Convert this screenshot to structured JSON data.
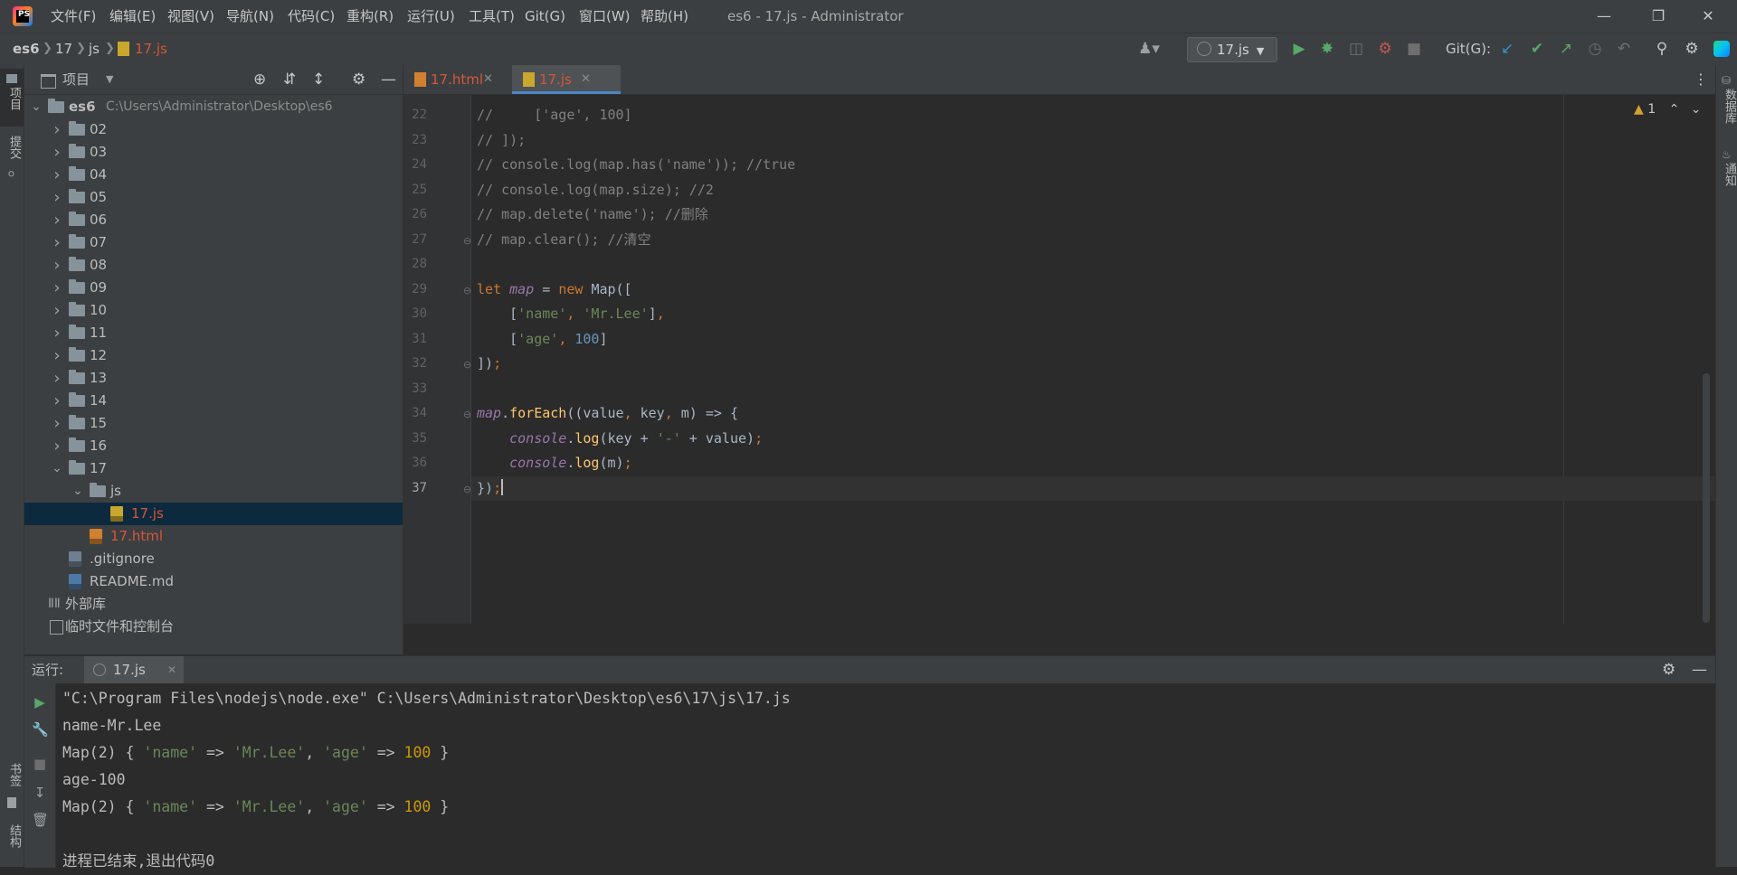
{
  "app": {
    "window_title": "es6 - 17.js - Administrator",
    "logo_text": "PS"
  },
  "menu": [
    "文件(F)",
    "编辑(E)",
    "视图(V)",
    "导航(N)",
    "代码(C)",
    "重构(R)",
    "运行(U)",
    "工具(T)",
    "Git(G)",
    "窗口(W)",
    "帮助(H)"
  ],
  "breadcrumb": [
    "es6",
    "17",
    "js",
    "17.js"
  ],
  "toolbar": {
    "run_config": "17.js",
    "git_label": "Git(G):"
  },
  "left_strip": {
    "project": "项目",
    "commit": "提交",
    "bookmarks": "书签",
    "structure": "结构"
  },
  "right_strip": {
    "database": "数据库",
    "notifications": "通知"
  },
  "project_panel": {
    "title": "项目",
    "tree": [
      {
        "label": "es6",
        "path": "C:\\Users\\Administrator\\Desktop\\es6",
        "type": "folder",
        "depth": 0,
        "expanded": true
      },
      {
        "label": "02",
        "type": "folder",
        "depth": 1,
        "expanded": false
      },
      {
        "label": "03",
        "type": "folder",
        "depth": 1,
        "expanded": false
      },
      {
        "label": "04",
        "type": "folder",
        "depth": 1,
        "expanded": false
      },
      {
        "label": "05",
        "type": "folder",
        "depth": 1,
        "expanded": false
      },
      {
        "label": "06",
        "type": "folder",
        "depth": 1,
        "expanded": false
      },
      {
        "label": "07",
        "type": "folder",
        "depth": 1,
        "expanded": false
      },
      {
        "label": "08",
        "type": "folder",
        "depth": 1,
        "expanded": false
      },
      {
        "label": "09",
        "type": "folder",
        "depth": 1,
        "expanded": false
      },
      {
        "label": "10",
        "type": "folder",
        "depth": 1,
        "expanded": false
      },
      {
        "label": "11",
        "type": "folder",
        "depth": 1,
        "expanded": false
      },
      {
        "label": "12",
        "type": "folder",
        "depth": 1,
        "expanded": false
      },
      {
        "label": "13",
        "type": "folder",
        "depth": 1,
        "expanded": false
      },
      {
        "label": "14",
        "type": "folder",
        "depth": 1,
        "expanded": false
      },
      {
        "label": "15",
        "type": "folder",
        "depth": 1,
        "expanded": false
      },
      {
        "label": "16",
        "type": "folder",
        "depth": 1,
        "expanded": false
      },
      {
        "label": "17",
        "type": "folder",
        "depth": 1,
        "expanded": true
      },
      {
        "label": "js",
        "type": "folder",
        "depth": 2,
        "expanded": true
      },
      {
        "label": "17.js",
        "type": "js",
        "depth": 3,
        "selected": true
      },
      {
        "label": "17.html",
        "type": "html",
        "depth": 2
      },
      {
        "label": ".gitignore",
        "type": "git",
        "depth": 1
      },
      {
        "label": "README.md",
        "type": "md",
        "depth": 1
      },
      {
        "label": "外部库",
        "type": "lib",
        "depth": 0
      },
      {
        "label": "临时文件和控制台",
        "type": "scratch",
        "depth": 0
      }
    ]
  },
  "editor": {
    "tabs": [
      {
        "label": "17.html",
        "active": false
      },
      {
        "label": "17.js",
        "active": true
      }
    ],
    "inspection_count": "1",
    "current_line": 37,
    "lines": [
      {
        "n": "22",
        "tokens": [
          [
            "com",
            "//     ['age', 100]"
          ]
        ]
      },
      {
        "n": "23",
        "tokens": [
          [
            "com",
            "// ]);"
          ]
        ]
      },
      {
        "n": "24",
        "tokens": [
          [
            "com",
            "// console.log(map.has('name')); //true"
          ]
        ]
      },
      {
        "n": "25",
        "tokens": [
          [
            "com",
            "// console.log(map.size); //2"
          ]
        ]
      },
      {
        "n": "26",
        "tokens": [
          [
            "com",
            "// map.delete('name'); //删除"
          ]
        ]
      },
      {
        "n": "27",
        "tokens": [
          [
            "com",
            "// map.clear(); //清空"
          ]
        ]
      },
      {
        "n": "28",
        "tokens": []
      },
      {
        "n": "29",
        "tokens": [
          [
            "kw",
            "let "
          ],
          [
            "var",
            "map"
          ],
          [
            "def",
            " = "
          ],
          [
            "kw",
            "new "
          ],
          [
            "def",
            "Map(["
          ]
        ]
      },
      {
        "n": "30",
        "tokens": [
          [
            "def",
            "    ["
          ],
          [
            "str",
            "'name'"
          ],
          [
            "kw",
            ", "
          ],
          [
            "str",
            "'Mr.Lee'"
          ],
          [
            "def",
            "]"
          ],
          [
            "kw",
            ","
          ]
        ]
      },
      {
        "n": "31",
        "tokens": [
          [
            "def",
            "    ["
          ],
          [
            "str",
            "'age'"
          ],
          [
            "kw",
            ", "
          ],
          [
            "num",
            "100"
          ],
          [
            "def",
            "]"
          ]
        ]
      },
      {
        "n": "32",
        "tokens": [
          [
            "def",
            "])"
          ],
          [
            "kw",
            ";"
          ]
        ]
      },
      {
        "n": "33",
        "tokens": []
      },
      {
        "n": "34",
        "tokens": [
          [
            "var",
            "map"
          ],
          [
            "def",
            "."
          ],
          [
            "fn",
            "forEach"
          ],
          [
            "def",
            "((value"
          ],
          [
            "kw",
            ", "
          ],
          [
            "def",
            "key"
          ],
          [
            "kw",
            ", "
          ],
          [
            "def",
            "m) => {"
          ]
        ]
      },
      {
        "n": "35",
        "tokens": [
          [
            "def",
            "    "
          ],
          [
            "var",
            "console"
          ],
          [
            "def",
            "."
          ],
          [
            "fn",
            "log"
          ],
          [
            "def",
            "(key + "
          ],
          [
            "str",
            "'-'"
          ],
          [
            "def",
            " + value)"
          ],
          [
            "kw",
            ";"
          ]
        ]
      },
      {
        "n": "36",
        "tokens": [
          [
            "def",
            "    "
          ],
          [
            "var",
            "console"
          ],
          [
            "def",
            "."
          ],
          [
            "fn",
            "log"
          ],
          [
            "def",
            "(m)"
          ],
          [
            "kw",
            ";"
          ]
        ]
      },
      {
        "n": "37",
        "tokens": [
          [
            "def",
            "})"
          ],
          [
            "kw",
            ";"
          ]
        ]
      }
    ]
  },
  "run_panel": {
    "label": "运行:",
    "tab": "17.js",
    "output": [
      [
        [
          "def",
          "\"C:\\Program Files\\nodejs\\node.exe\" C:\\Users\\Administrator\\Desktop\\es6\\17\\js\\17.js"
        ]
      ],
      [
        [
          "def",
          "name-Mr.Lee"
        ]
      ],
      [
        [
          "def",
          "Map(2) { "
        ],
        [
          "str",
          "'name'"
        ],
        [
          "def",
          " => "
        ],
        [
          "str",
          "'Mr.Lee'"
        ],
        [
          "def",
          ", "
        ],
        [
          "str",
          "'age'"
        ],
        [
          "def",
          " => "
        ],
        [
          "num",
          "100"
        ],
        [
          "def",
          " }"
        ]
      ],
      [
        [
          "def",
          "age-100"
        ]
      ],
      [
        [
          "def",
          "Map(2) { "
        ],
        [
          "str",
          "'name'"
        ],
        [
          "def",
          " => "
        ],
        [
          "str",
          "'Mr.Lee'"
        ],
        [
          "def",
          ", "
        ],
        [
          "str",
          "'age'"
        ],
        [
          "def",
          " => "
        ],
        [
          "num",
          "100"
        ],
        [
          "def",
          " }"
        ]
      ],
      [],
      [
        [
          "def",
          "进程已结束,退出代码0"
        ]
      ]
    ]
  },
  "colors": {
    "accent": "#4a88c7",
    "run_green": "#59a869",
    "modified_file": "#d4573b"
  }
}
